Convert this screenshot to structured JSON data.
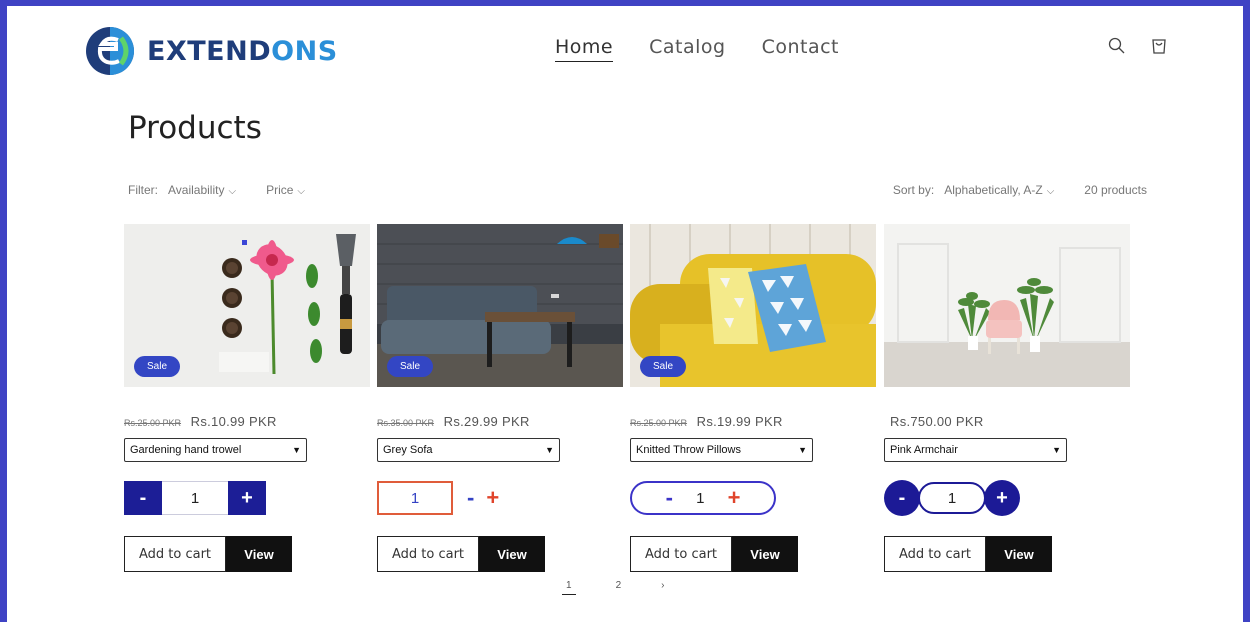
{
  "brand": {
    "part1": "EXTEND",
    "part2": "ONS"
  },
  "nav": {
    "home": "Home",
    "catalog": "Catalog",
    "contact": "Contact"
  },
  "page": {
    "title": "Products"
  },
  "filters": {
    "label": "Filter:",
    "availability": "Availability",
    "price": "Price",
    "sort_label": "Sort by:",
    "sort_value": "Alphabetically, A-Z",
    "count": "20 products"
  },
  "products": [
    {
      "badge": "Sale",
      "old_price": "Rs.25.00 PKR",
      "price": "Rs.10.99 PKR",
      "variant": "Gardening hand trowel",
      "qty": "1",
      "minus": "-",
      "plus": "+",
      "add": "Add to cart",
      "view": "View"
    },
    {
      "badge": "Sale",
      "old_price": "Rs.35.00 PKR",
      "price": "Rs.29.99 PKR",
      "variant": "Grey Sofa",
      "qty": "1",
      "minus": "-",
      "plus": "+",
      "add": "Add to cart",
      "view": "View"
    },
    {
      "badge": "Sale",
      "old_price": "Rs.25.00 PKR",
      "price": "Rs.19.99 PKR",
      "variant": "Knitted Throw Pillows",
      "qty": "1",
      "minus": "-",
      "plus": "+",
      "add": "Add to cart",
      "view": "View"
    },
    {
      "badge": "",
      "old_price": "",
      "price": "Rs.750.00 PKR",
      "variant": "Pink Armchair",
      "qty": "1",
      "minus": "-",
      "plus": "+",
      "add": "Add to cart",
      "view": "View"
    }
  ],
  "pagination": {
    "p1": "1",
    "p2": "2",
    "next": "›"
  },
  "colors": {
    "frame": "#3f43c4",
    "accent": "#1c1e96",
    "sale_badge": "#3346c4",
    "plus_red": "#e0442b"
  }
}
